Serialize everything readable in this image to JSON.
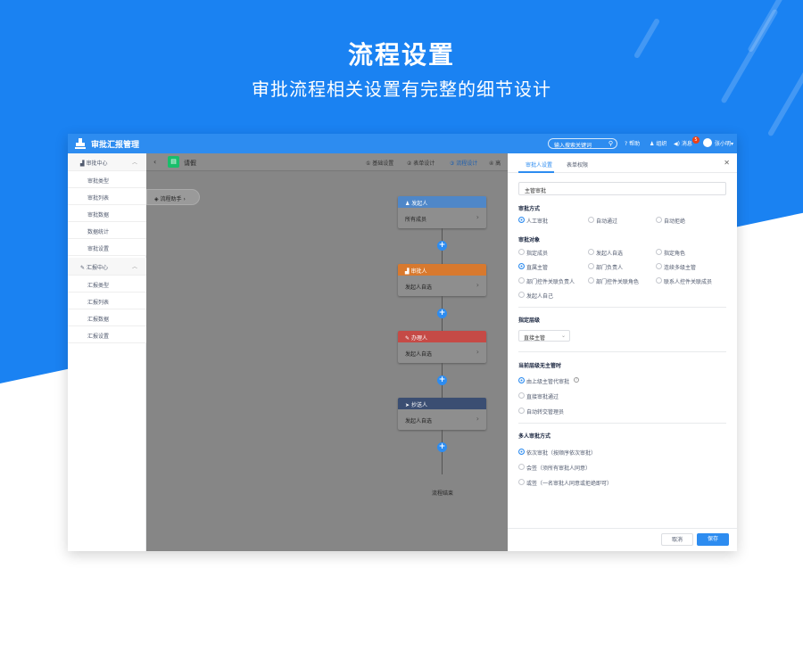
{
  "hero": {
    "title": "流程设置",
    "subtitle": "审批流程相关设置有完整的细节设计"
  },
  "topbar": {
    "brand": "审批汇报管理",
    "search_placeholder": "输入搜索关键词",
    "help": "帮助",
    "org": "组织",
    "messages": "消息",
    "message_count": "5",
    "user": "张小明"
  },
  "sidebar": {
    "approval_center": "审批中心",
    "approval_items": [
      "审批类型",
      "审批列表",
      "审批数据",
      "数据统计",
      "审批设置"
    ],
    "report_center": "汇报中心",
    "report_items": [
      "汇报类型",
      "汇报列表",
      "汇报数据",
      "汇报设置"
    ]
  },
  "canvas": {
    "form_name": "请假",
    "steps": [
      {
        "n": "1",
        "label": "基础设置"
      },
      {
        "n": "2",
        "label": "表单设计"
      },
      {
        "n": "3",
        "label": "流程设计"
      },
      {
        "n": "4",
        "label": "高"
      }
    ],
    "helper": "流程助手",
    "nodes": [
      {
        "title": "发起人",
        "body": "所有成员",
        "color": "#4f87c8"
      },
      {
        "title": "审批人",
        "body": "发起人自选",
        "color": "#d8792e"
      },
      {
        "title": "办理人",
        "body": "发起人自选",
        "color": "#c54a46"
      },
      {
        "title": "抄送人",
        "body": "发起人自选",
        "color": "#3b4e72"
      }
    ],
    "end": "流程结束"
  },
  "panel": {
    "tabs": [
      "审批人设置",
      "表单权限"
    ],
    "node_name": "主管审批",
    "approval_method_title": "审批方式",
    "approval_methods": [
      "人工审批",
      "自动通过",
      "自动拒绝"
    ],
    "approver_title": "审批对象",
    "approvers": [
      "指定成员",
      "发起人自选",
      "指定角色",
      "直属主管",
      "部门负责人",
      "连续多级主管",
      "部门控件关联负责人",
      "部门控件关联角色",
      "联系人控件关联成员",
      "发起人自己"
    ],
    "level_title": "指定层级",
    "level_value": "直接主管",
    "no_supervisor_title": "当前层级无主管时",
    "no_supervisor_options": [
      "由上级主管代审批",
      "直接审批通过",
      "自动转交管理员"
    ],
    "multi_title": "多人审批方式",
    "multi_options": [
      "依次审批（按顺序依次审批）",
      "会签（须所有审批人同意）",
      "或签（一名审批人同意或拒绝即可）"
    ],
    "cancel": "取消",
    "save": "保存"
  },
  "colors": {
    "primary": "#2d8cf0",
    "background": "#1a82f2"
  }
}
